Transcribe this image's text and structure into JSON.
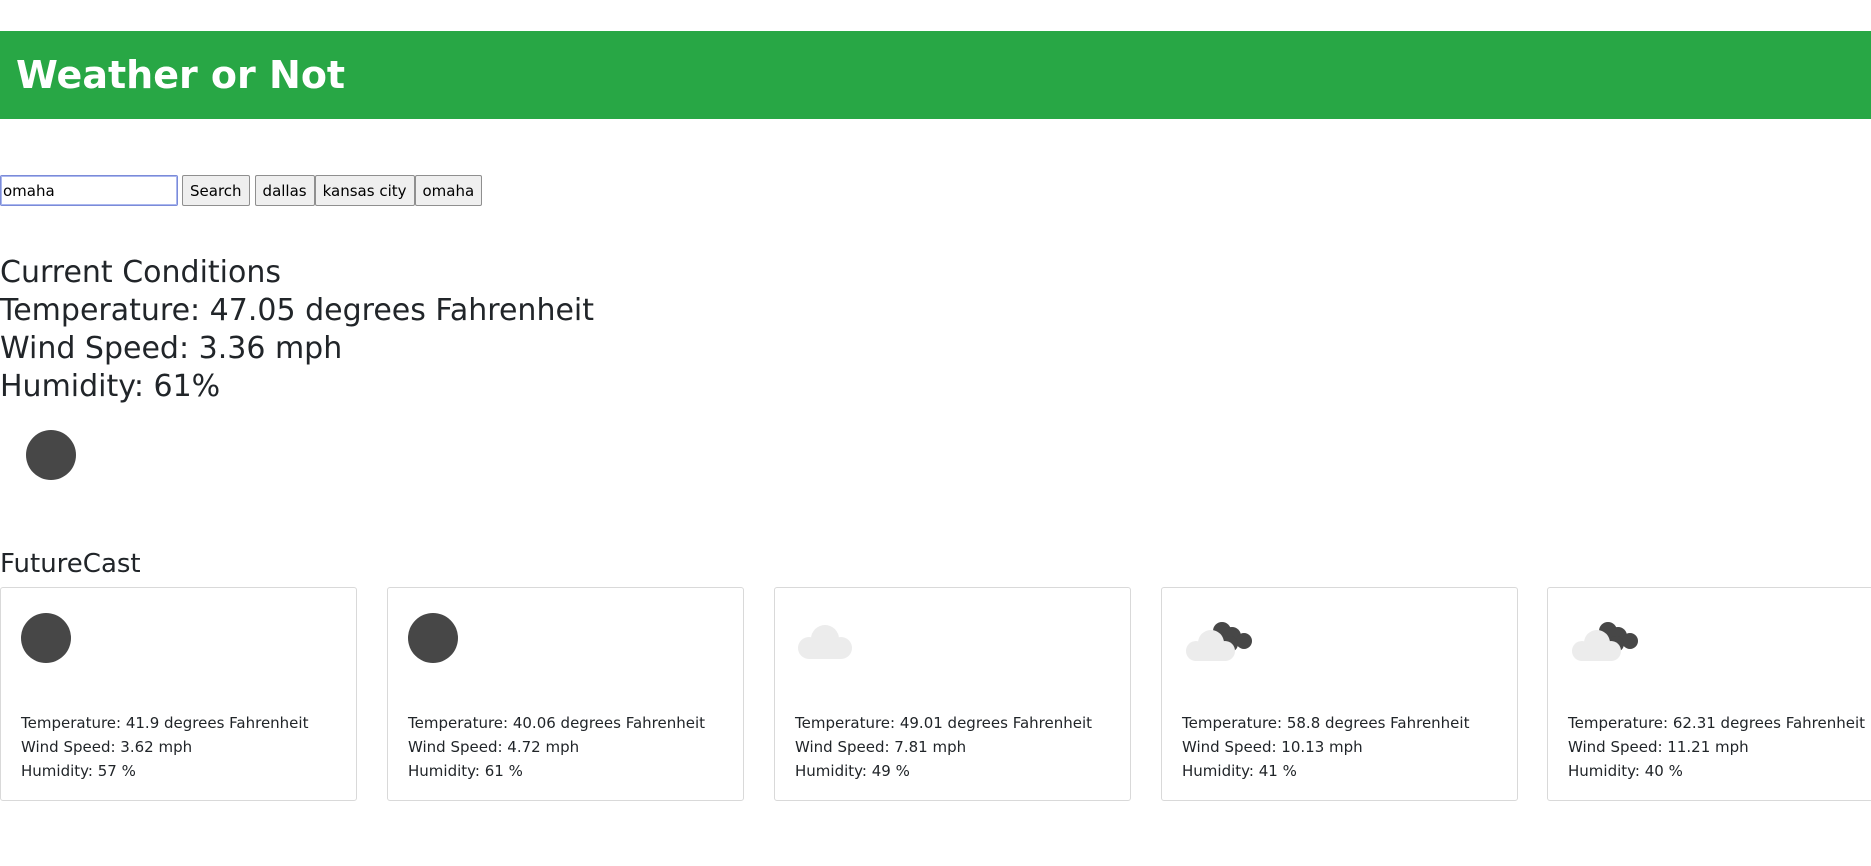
{
  "header": {
    "title": "Weather or Not",
    "color": "#28a745"
  },
  "search": {
    "value": "omaha",
    "button_label": "Search",
    "history": [
      "dallas",
      "kansas city",
      "omaha"
    ]
  },
  "current": {
    "heading": "Current Conditions",
    "temperature": "Temperature: 47.05 degrees Fahrenheit",
    "wind": "Wind Speed: 3.36 mph",
    "humidity": "Humidity: 61%",
    "icon": "moon-icon"
  },
  "futurecast": {
    "title": "FutureCast",
    "cards": [
      {
        "icon": "moon-icon",
        "temperature": "Temperature: 41.9 degrees Fahrenheit",
        "wind": "Wind Speed: 3.62 mph",
        "humidity": "Humidity: 57 %"
      },
      {
        "icon": "moon-icon",
        "temperature": "Temperature: 40.06 degrees Fahrenheit",
        "wind": "Wind Speed: 4.72 mph",
        "humidity": "Humidity: 61 %"
      },
      {
        "icon": "cloud-icon",
        "temperature": "Temperature: 49.01 degrees Fahrenheit",
        "wind": "Wind Speed: 7.81 mph",
        "humidity": "Humidity: 49 %"
      },
      {
        "icon": "broken-clouds-icon",
        "temperature": "Temperature: 58.8 degrees Fahrenheit",
        "wind": "Wind Speed: 10.13 mph",
        "humidity": "Humidity: 41 %"
      },
      {
        "icon": "broken-clouds-icon",
        "temperature": "Temperature: 62.31 degrees Fahrenheit",
        "wind": "Wind Speed: 11.21 mph",
        "humidity": "Humidity: 40 %"
      }
    ]
  }
}
